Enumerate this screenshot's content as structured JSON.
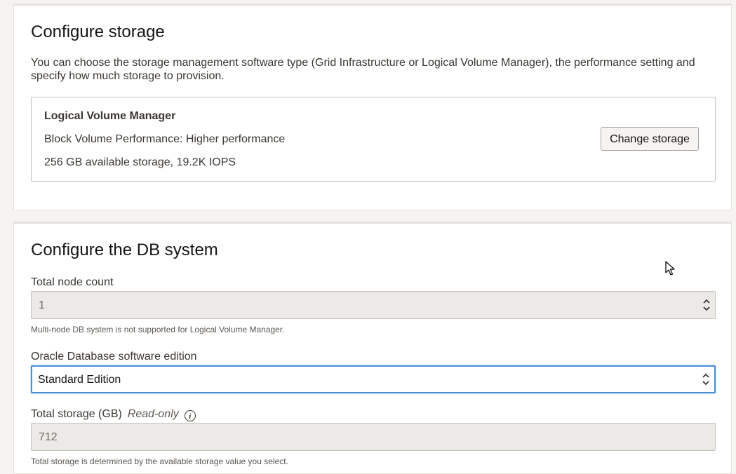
{
  "storage_section": {
    "title": "Configure storage",
    "description": "You can choose the storage management software type (Grid Infrastructure or Logical Volume Manager), the performance setting and specify how much storage to provision.",
    "box": {
      "name": "Logical Volume Manager",
      "performance": "Block Volume Performance: Higher performance",
      "capacity": "256 GB available storage, 19.2K IOPS",
      "change_button": "Change storage"
    }
  },
  "db_section": {
    "title": "Configure the DB system",
    "node_count": {
      "label": "Total node count",
      "value": "1",
      "help": "Multi-node DB system is not supported for Logical Volume Manager."
    },
    "edition": {
      "label": "Oracle Database software edition",
      "value": "Standard Edition"
    },
    "total_storage": {
      "label": "Total storage (GB)",
      "readonly_note": "Read-only",
      "value": "712",
      "help": "Total storage is determined by the available storage value you select."
    }
  },
  "colors": {
    "focus_border": "#4d90d6",
    "readonly_bg": "#eceae7"
  },
  "icons": [
    "info-icon",
    "spinner-icon",
    "mouse-pointer-icon"
  ]
}
